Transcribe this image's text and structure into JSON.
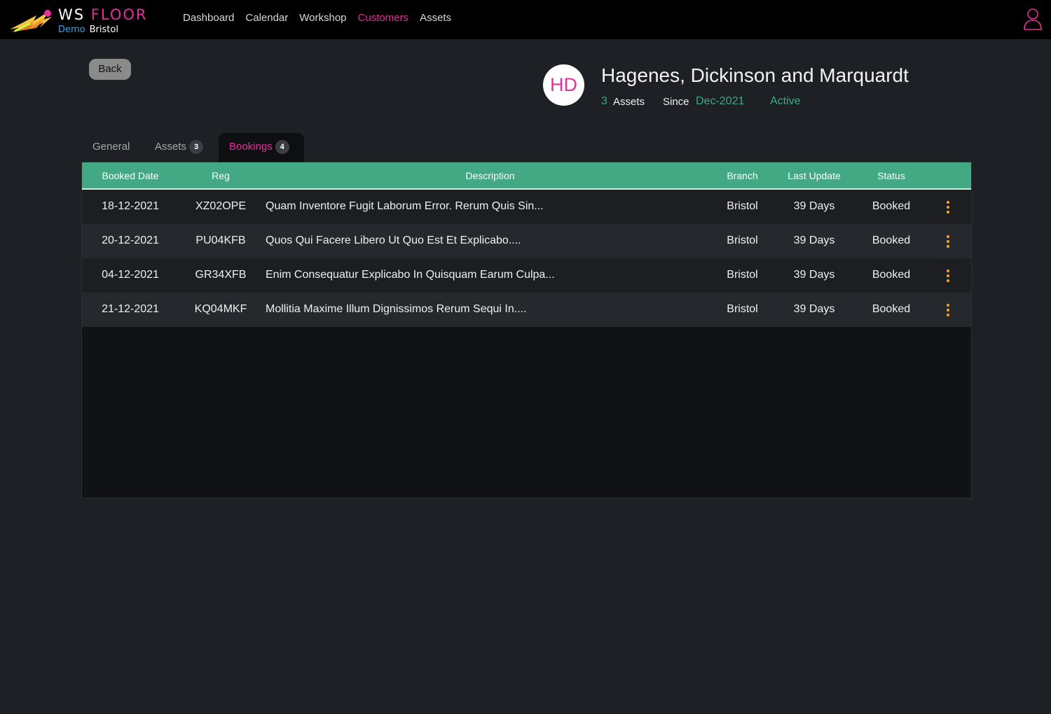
{
  "app": {
    "brand_word1": "WS",
    "brand_word2": "FLOOR",
    "sub_demo": "Demo",
    "sub_branch": "Bristol",
    "logo_icon": "comet-icon"
  },
  "nav": {
    "items": [
      {
        "label": "Dashboard",
        "active": false
      },
      {
        "label": "Calendar",
        "active": false
      },
      {
        "label": "Workshop",
        "active": false
      },
      {
        "label": "Customers",
        "active": true
      },
      {
        "label": "Assets",
        "active": false
      }
    ],
    "user_icon": "user-icon"
  },
  "back_label": "Back",
  "customer": {
    "initials": "HD",
    "name": "Hagenes, Dickinson and Marquardt",
    "asset_count": "3",
    "assets_label": "Assets",
    "since_label": "Since",
    "since_value": "Dec-2021",
    "status": "Active"
  },
  "tabs": [
    {
      "label": "General",
      "count": null,
      "active": false
    },
    {
      "label": "Assets",
      "count": "3",
      "active": false
    },
    {
      "label": "Bookings",
      "count": "4",
      "active": true
    }
  ],
  "table": {
    "columns": [
      "Booked Date",
      "Reg",
      "Description",
      "Branch",
      "Last Update",
      "Status"
    ],
    "rows": [
      {
        "booked_date": "18-12-2021",
        "reg": "XZ02OPE",
        "description": "Quam Inventore Fugit Laborum Error. Rerum Quis Sin...",
        "branch": "Bristol",
        "last_update": "39 Days",
        "status": "Booked"
      },
      {
        "booked_date": "20-12-2021",
        "reg": "PU04KFB",
        "description": "Quos Qui Facere Libero Ut Quo Est Et Explicabo....",
        "branch": "Bristol",
        "last_update": "39 Days",
        "status": "Booked"
      },
      {
        "booked_date": "04-12-2021",
        "reg": "GR34XFB",
        "description": "Enim Consequatur Explicabo In Quisquam Earum Culpa...",
        "branch": "Bristol",
        "last_update": "39 Days",
        "status": "Booked"
      },
      {
        "booked_date": "21-12-2021",
        "reg": "KQ04MKF",
        "description": "Mollitia Maxime Illum Dignissimos Rerum Sequi In....",
        "branch": "Bristol",
        "last_update": "39 Days",
        "status": "Booked"
      }
    ],
    "row_menu_icon": "kebab-menu-icon"
  },
  "colors": {
    "accent_pink": "#e62e9e",
    "accent_green": "#43a884",
    "accent_blue": "#36a8f0",
    "menu_orange": "#f5a623",
    "page_bg": "#1d2024"
  }
}
